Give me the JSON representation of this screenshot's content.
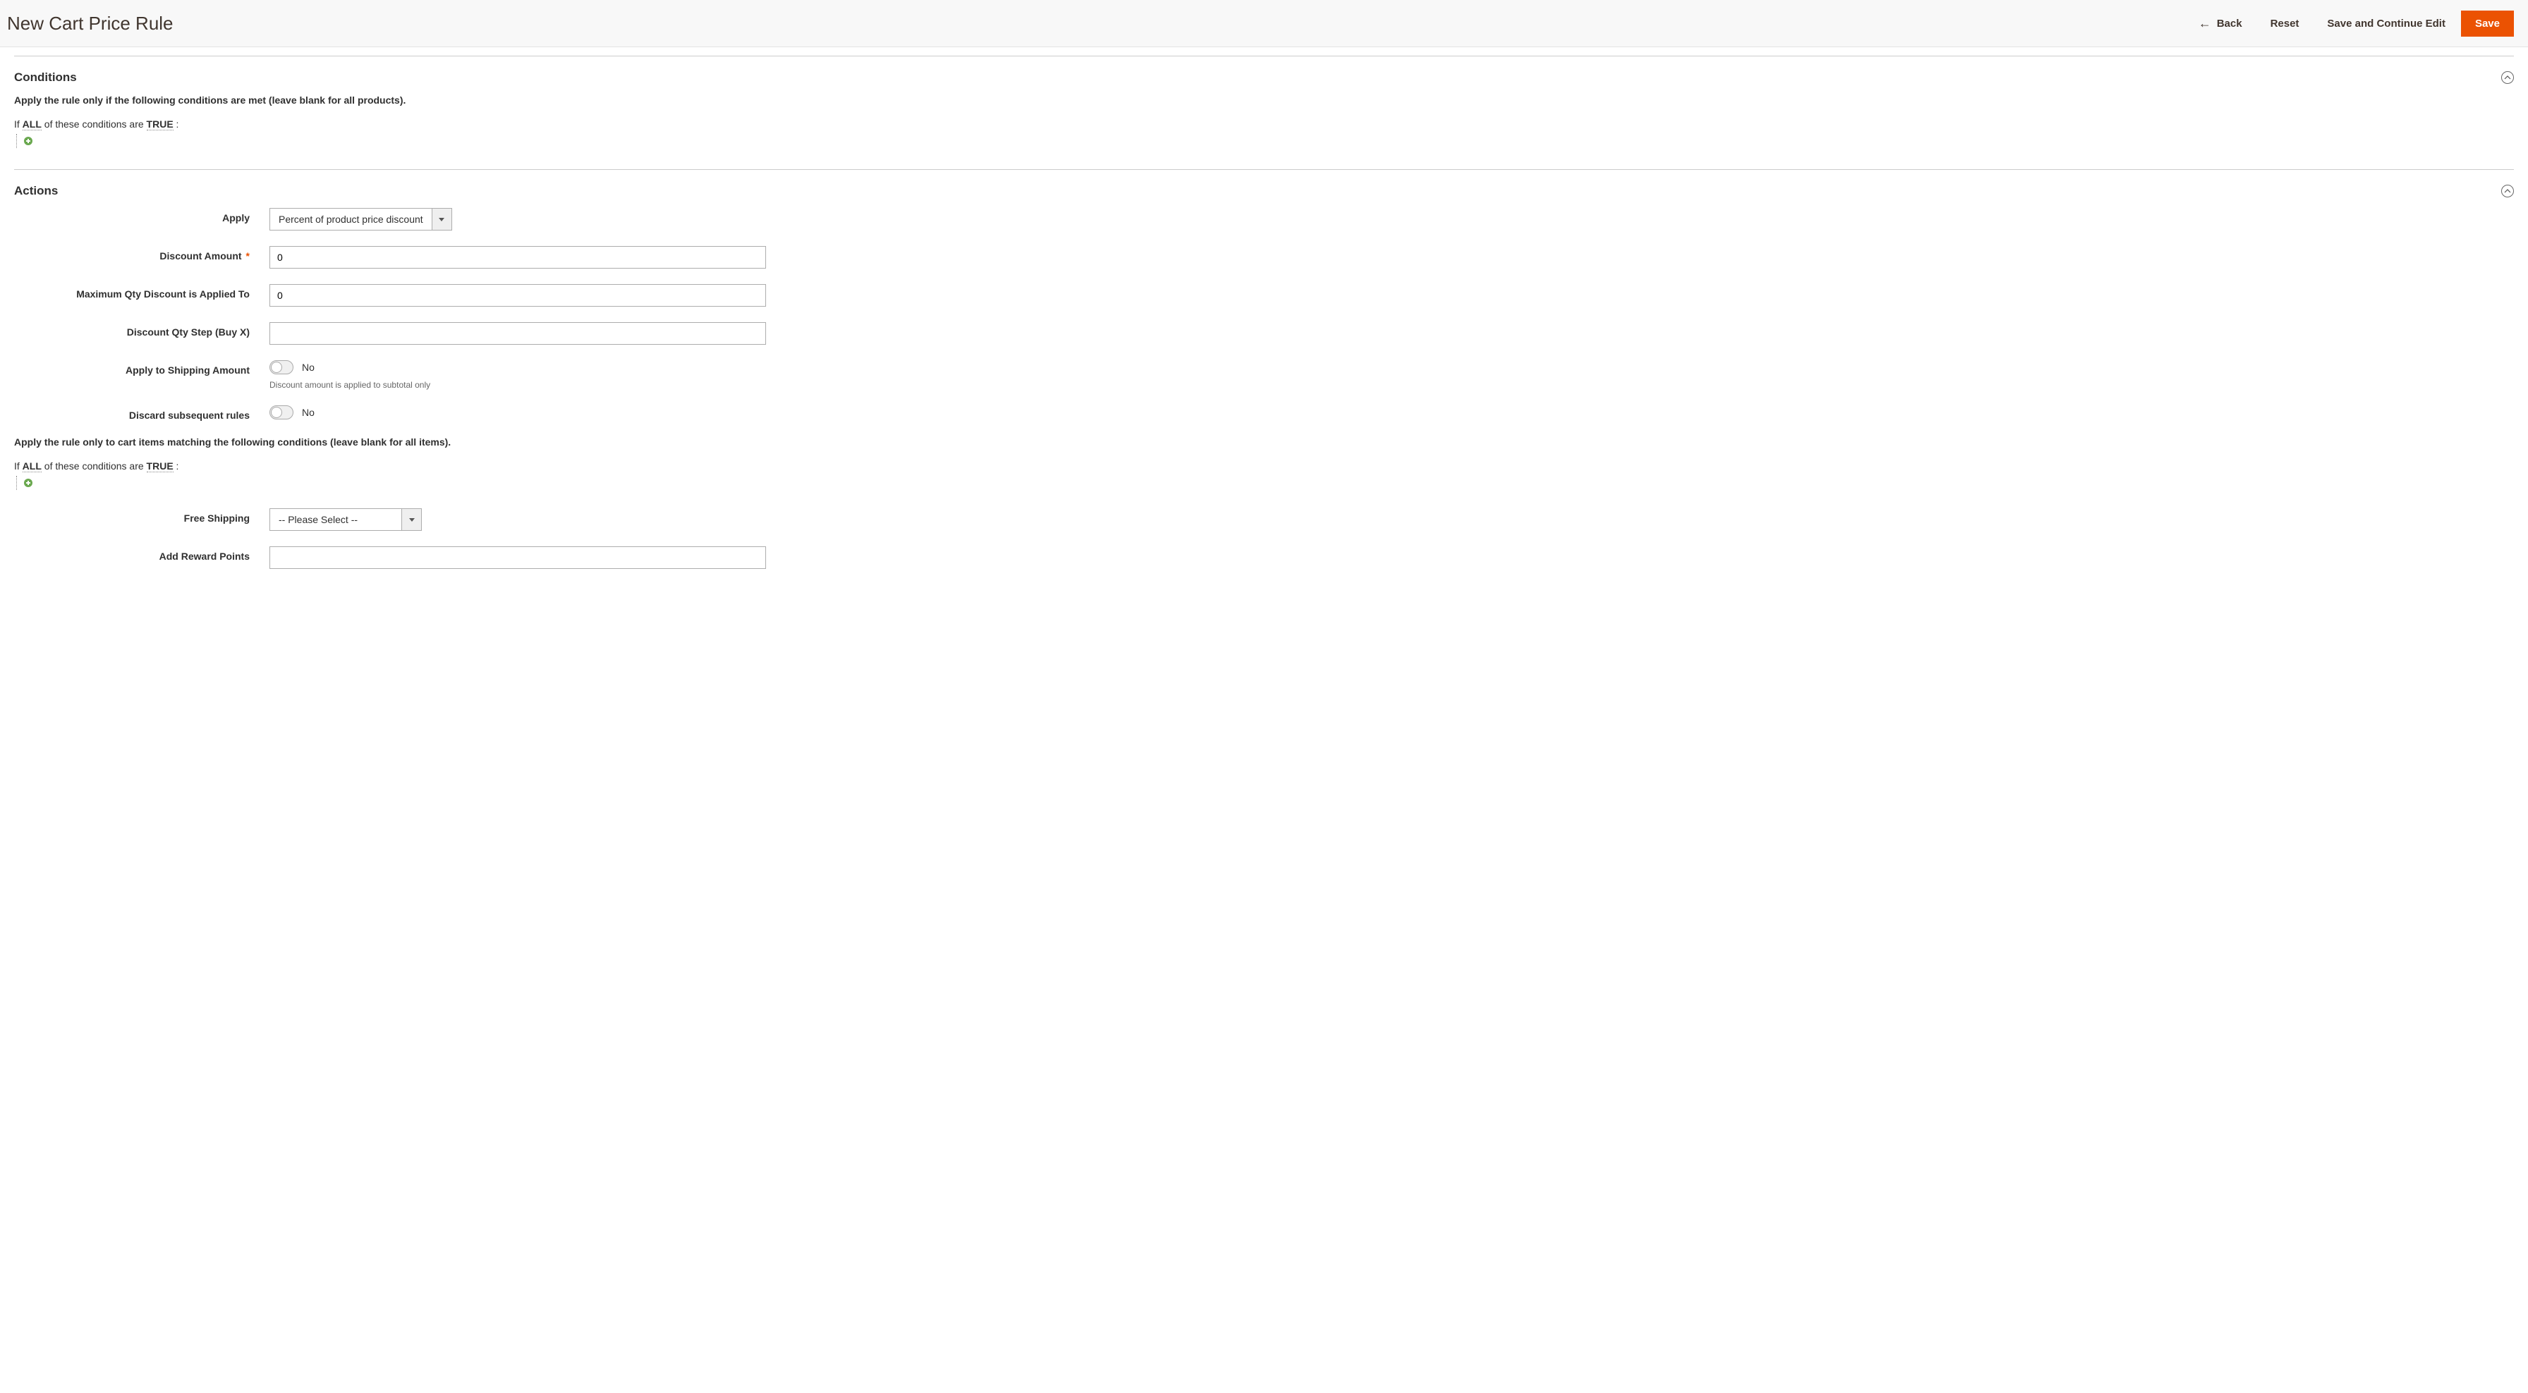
{
  "header": {
    "title": "New Cart Price Rule",
    "back": "Back",
    "reset": "Reset",
    "save_continue": "Save and Continue Edit",
    "save": "Save"
  },
  "conditions_section": {
    "title": "Conditions",
    "help": "Apply the rule only if the following conditions are met (leave blank for all products).",
    "if_prefix": "If ",
    "all": "ALL",
    "mid": " of these conditions are ",
    "true_val": "TRUE",
    "suffix": " :"
  },
  "actions_section": {
    "title": "Actions",
    "apply_label": "Apply",
    "apply_value": "Percent of product price discount",
    "discount_amount_label": "Discount Amount",
    "discount_amount_value": "0",
    "max_qty_label": "Maximum Qty Discount is Applied To",
    "max_qty_value": "0",
    "qty_step_label": "Discount Qty Step (Buy X)",
    "qty_step_value": "",
    "apply_shipping_label": "Apply to Shipping Amount",
    "apply_shipping_value": "No",
    "apply_shipping_note": "Discount amount is applied to subtotal only",
    "discard_label": "Discard subsequent rules",
    "discard_value": "No",
    "items_help": "Apply the rule only to cart items matching the following conditions (leave blank for all items).",
    "if_prefix": "If ",
    "all": "ALL",
    "mid": " of these conditions are ",
    "true_val": "TRUE",
    "suffix": " :",
    "free_shipping_label": "Free Shipping",
    "free_shipping_value": "-- Please Select --",
    "reward_points_label": "Add Reward Points",
    "reward_points_value": ""
  }
}
